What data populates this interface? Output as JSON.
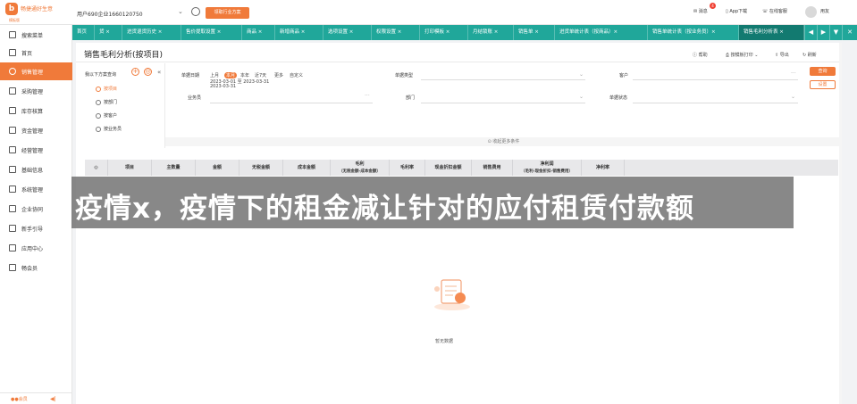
{
  "app": {
    "logo_text": "畅捷通好生意",
    "logo_sub": "模板版",
    "account": "用户690企业1660120750",
    "plan_button": "领取行业方案",
    "messages": "消息",
    "message_badge": "4",
    "app_download": "App下载",
    "online_service": "在线客服",
    "user": "用友"
  },
  "sidebar": {
    "items": [
      {
        "label": "搜索菜单",
        "icon": "search-icon"
      },
      {
        "label": "首页",
        "icon": "home-icon"
      },
      {
        "label": "销售管理",
        "icon": "sales-icon"
      },
      {
        "label": "采购管理",
        "icon": "purchase-icon"
      },
      {
        "label": "库存核算",
        "icon": "inventory-icon"
      },
      {
        "label": "资金管理",
        "icon": "funds-icon"
      },
      {
        "label": "经营管理",
        "icon": "business-icon"
      },
      {
        "label": "基础信息",
        "icon": "info-icon"
      },
      {
        "label": "系统管理",
        "icon": "system-icon"
      },
      {
        "label": "企业协同",
        "icon": "collab-icon"
      },
      {
        "label": "新手引导",
        "icon": "guide-icon"
      },
      {
        "label": "应用中心",
        "icon": "apps-icon"
      },
      {
        "label": "畅会员",
        "icon": "member-icon"
      }
    ],
    "active_index": 2,
    "bottom_left": "●●会员",
    "bottom_right": "◀|"
  },
  "tabs": [
    {
      "label": "首页"
    },
    {
      "label": "货 ×"
    },
    {
      "label": "进货退货历史 ×"
    },
    {
      "label": "售价提取设置 ×"
    },
    {
      "label": "商品 ×"
    },
    {
      "label": "新增商品 ×"
    },
    {
      "label": "选项设置 ×"
    },
    {
      "label": "权限设置 ×"
    },
    {
      "label": "打印模板 ×"
    },
    {
      "label": "月结锁账 ×"
    },
    {
      "label": "销售单 ×"
    },
    {
      "label": "进货单统计表（按商品）×"
    },
    {
      "label": "销售单统计表（按业务员）×"
    },
    {
      "label": "销售毛利分析表 ×"
    }
  ],
  "tab_controls": [
    "◀",
    "▶",
    "▼",
    "✕"
  ],
  "page": {
    "title": "销售毛利分析(按项目)",
    "help": "帮助",
    "print": "按模板打印",
    "export": "导出",
    "refresh": "刷新"
  },
  "schemes": {
    "title": "我以下方案查询",
    "add": "+",
    "settings": "◎",
    "collapse": "«",
    "items": [
      "按项目",
      "按部门",
      "按客户",
      "按业务员"
    ],
    "active_index": 0
  },
  "filters": {
    "date_label": "单据日期",
    "date_options": [
      "上月",
      "本月",
      "本年",
      "近7天",
      "更多",
      "自定义"
    ],
    "date_active_index": 1,
    "date_range_line1": "2023-03-01 至 2023-03-31",
    "date_range_line2": "2023-03-31",
    "bill_type_label": "单据类型",
    "customer_label": "客户",
    "salesman_label": "业务员",
    "department_label": "部门",
    "bill_status_label": "单据状态",
    "query": "查询",
    "reset": "设置",
    "more_conditions": "⊙ 收起更多条件"
  },
  "grid": {
    "columns": [
      {
        "l1": "◎",
        "l2": ""
      },
      {
        "l1": "项目",
        "l2": ""
      },
      {
        "l1": "主数量",
        "l2": ""
      },
      {
        "l1": "金额",
        "l2": ""
      },
      {
        "l1": "无税金额",
        "l2": ""
      },
      {
        "l1": "成本金额",
        "l2": ""
      },
      {
        "l1": "毛利",
        "l2": "（无税金额-成本金额）"
      },
      {
        "l1": "毛利率",
        "l2": ""
      },
      {
        "l1": "现金折扣金额",
        "l2": ""
      },
      {
        "l1": "销售费用",
        "l2": ""
      },
      {
        "l1": "净利润",
        "l2": "（毛利-现金折扣-销售费用）"
      },
      {
        "l1": "净利率",
        "l2": ""
      }
    ],
    "empty_text": "暂无数据"
  },
  "banner": {
    "text": "疫情x，疫情下的租金减让针对的应付租赁付款额"
  },
  "colors": {
    "accent": "#f07a3a",
    "tabbar": "#20a79a",
    "tab_active": "#127a70"
  }
}
